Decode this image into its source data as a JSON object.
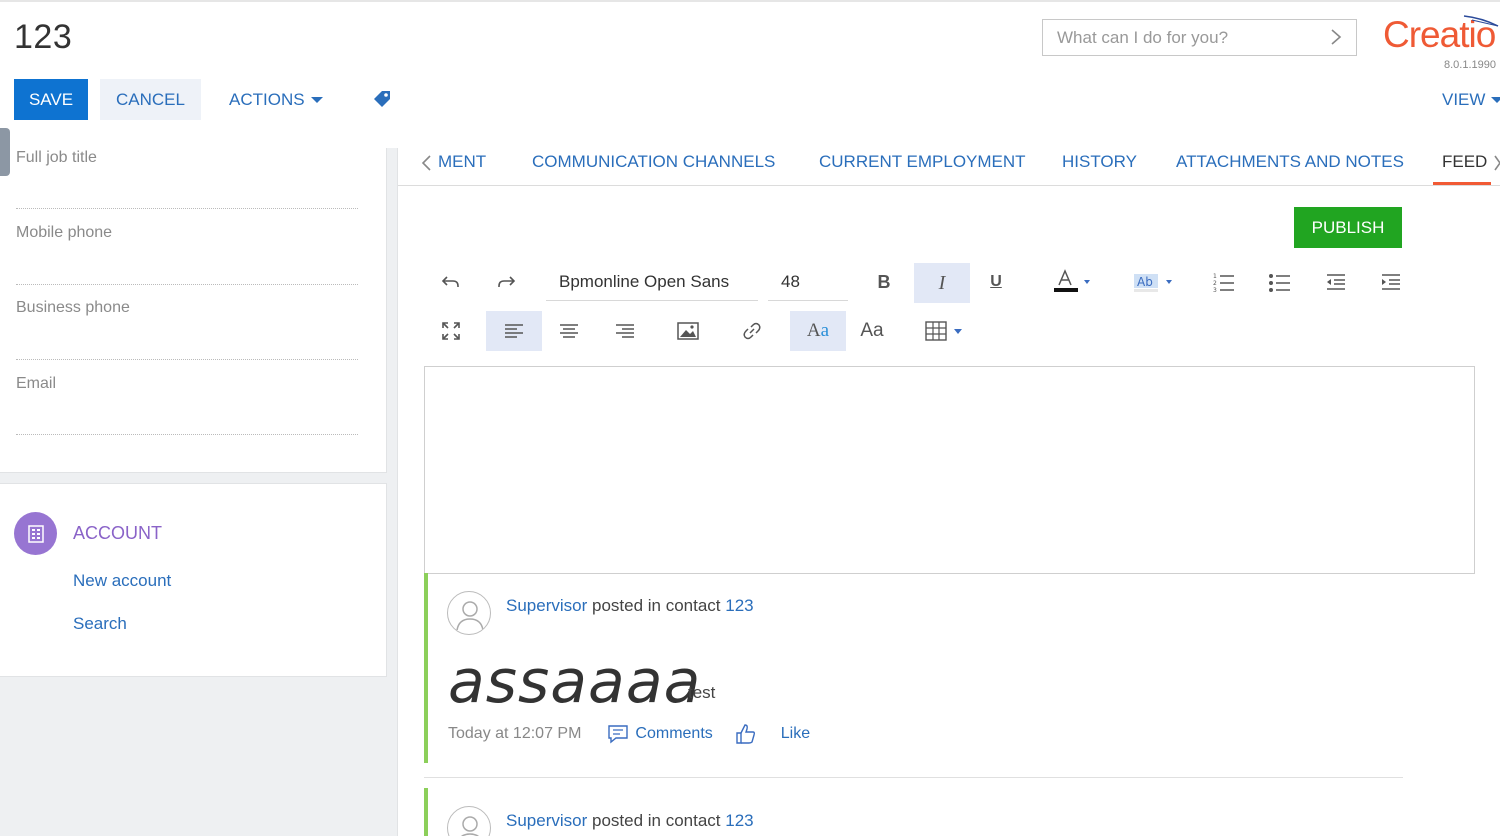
{
  "header": {
    "title": "123",
    "search_placeholder": "What can I do for you?",
    "logo_text": "Creatio",
    "version": "8.0.1.1990"
  },
  "toolbar": {
    "save_label": "SAVE",
    "cancel_label": "CANCEL",
    "actions_label": "ACTIONS",
    "view_label": "VIEW"
  },
  "left_panel": {
    "fields": [
      {
        "label": "Full job title"
      },
      {
        "label": "Mobile phone"
      },
      {
        "label": "Business phone"
      },
      {
        "label": "Email"
      }
    ],
    "account": {
      "title": "ACCOUNT",
      "links": [
        "New account",
        "Search"
      ]
    }
  },
  "tabs": [
    {
      "label": "MENT"
    },
    {
      "label": "COMMUNICATION CHANNELS"
    },
    {
      "label": "CURRENT EMPLOYMENT"
    },
    {
      "label": "HISTORY"
    },
    {
      "label": "ATTACHMENTS AND NOTES"
    },
    {
      "label": "FEED",
      "active": true
    }
  ],
  "feed": {
    "publish_label": "PUBLISH",
    "editor": {
      "font_family": "Bpmonline Open Sans",
      "font_size": "48"
    },
    "posts": [
      {
        "author": "Supervisor",
        "action": "posted in contact",
        "contact": "123",
        "big_text": "assaaaa",
        "small_text": "test",
        "time": "Today at 12:07 PM",
        "comments_label": "Comments",
        "like_label": "Like"
      },
      {
        "author": "Supervisor",
        "action": "posted in contact",
        "contact": "123"
      }
    ]
  },
  "colors": {
    "accent": "#0e73d1",
    "link": "#2a6ebb",
    "publish": "#21a521",
    "brand": "#ef5a35",
    "account": "#9775d2",
    "post_border": "#8ccf5a"
  }
}
